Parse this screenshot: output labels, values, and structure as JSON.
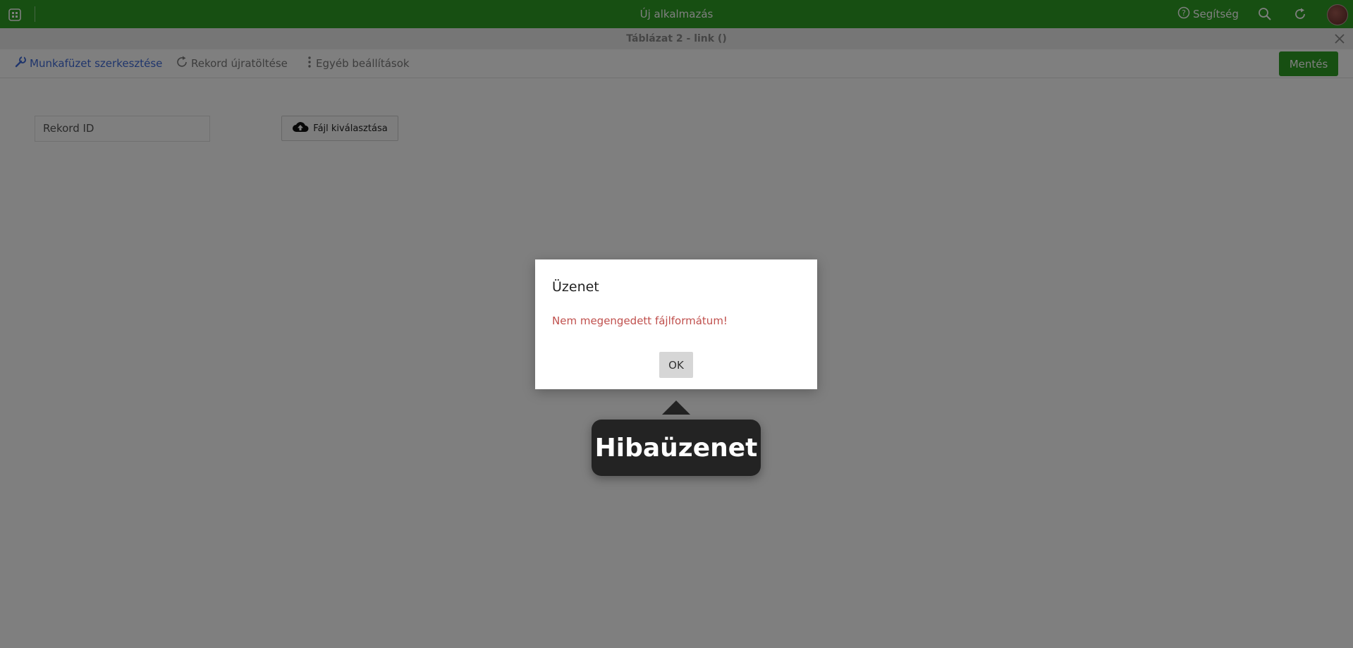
{
  "appbar": {
    "title": "Új alkalmazás",
    "help_label": "Segítség",
    "background": "#2e9e24"
  },
  "window": {
    "title": "Táblázat 2 - link ()"
  },
  "toolbar": {
    "edit_workbook": "Munkafüzet szerkesztése",
    "reload_record": "Rekord újratöltése",
    "other_settings": "Egyéb beállítások",
    "save": "Mentés"
  },
  "form": {
    "record_id_placeholder": "Rekord ID",
    "file_button": "Fájl kiválasztása"
  },
  "dialog": {
    "title": "Üzenet",
    "message": "Nem megengedett fájlformátum!",
    "ok": "OK",
    "message_color": "#c0504d"
  },
  "callout": {
    "label": "Hibaüzenet"
  }
}
